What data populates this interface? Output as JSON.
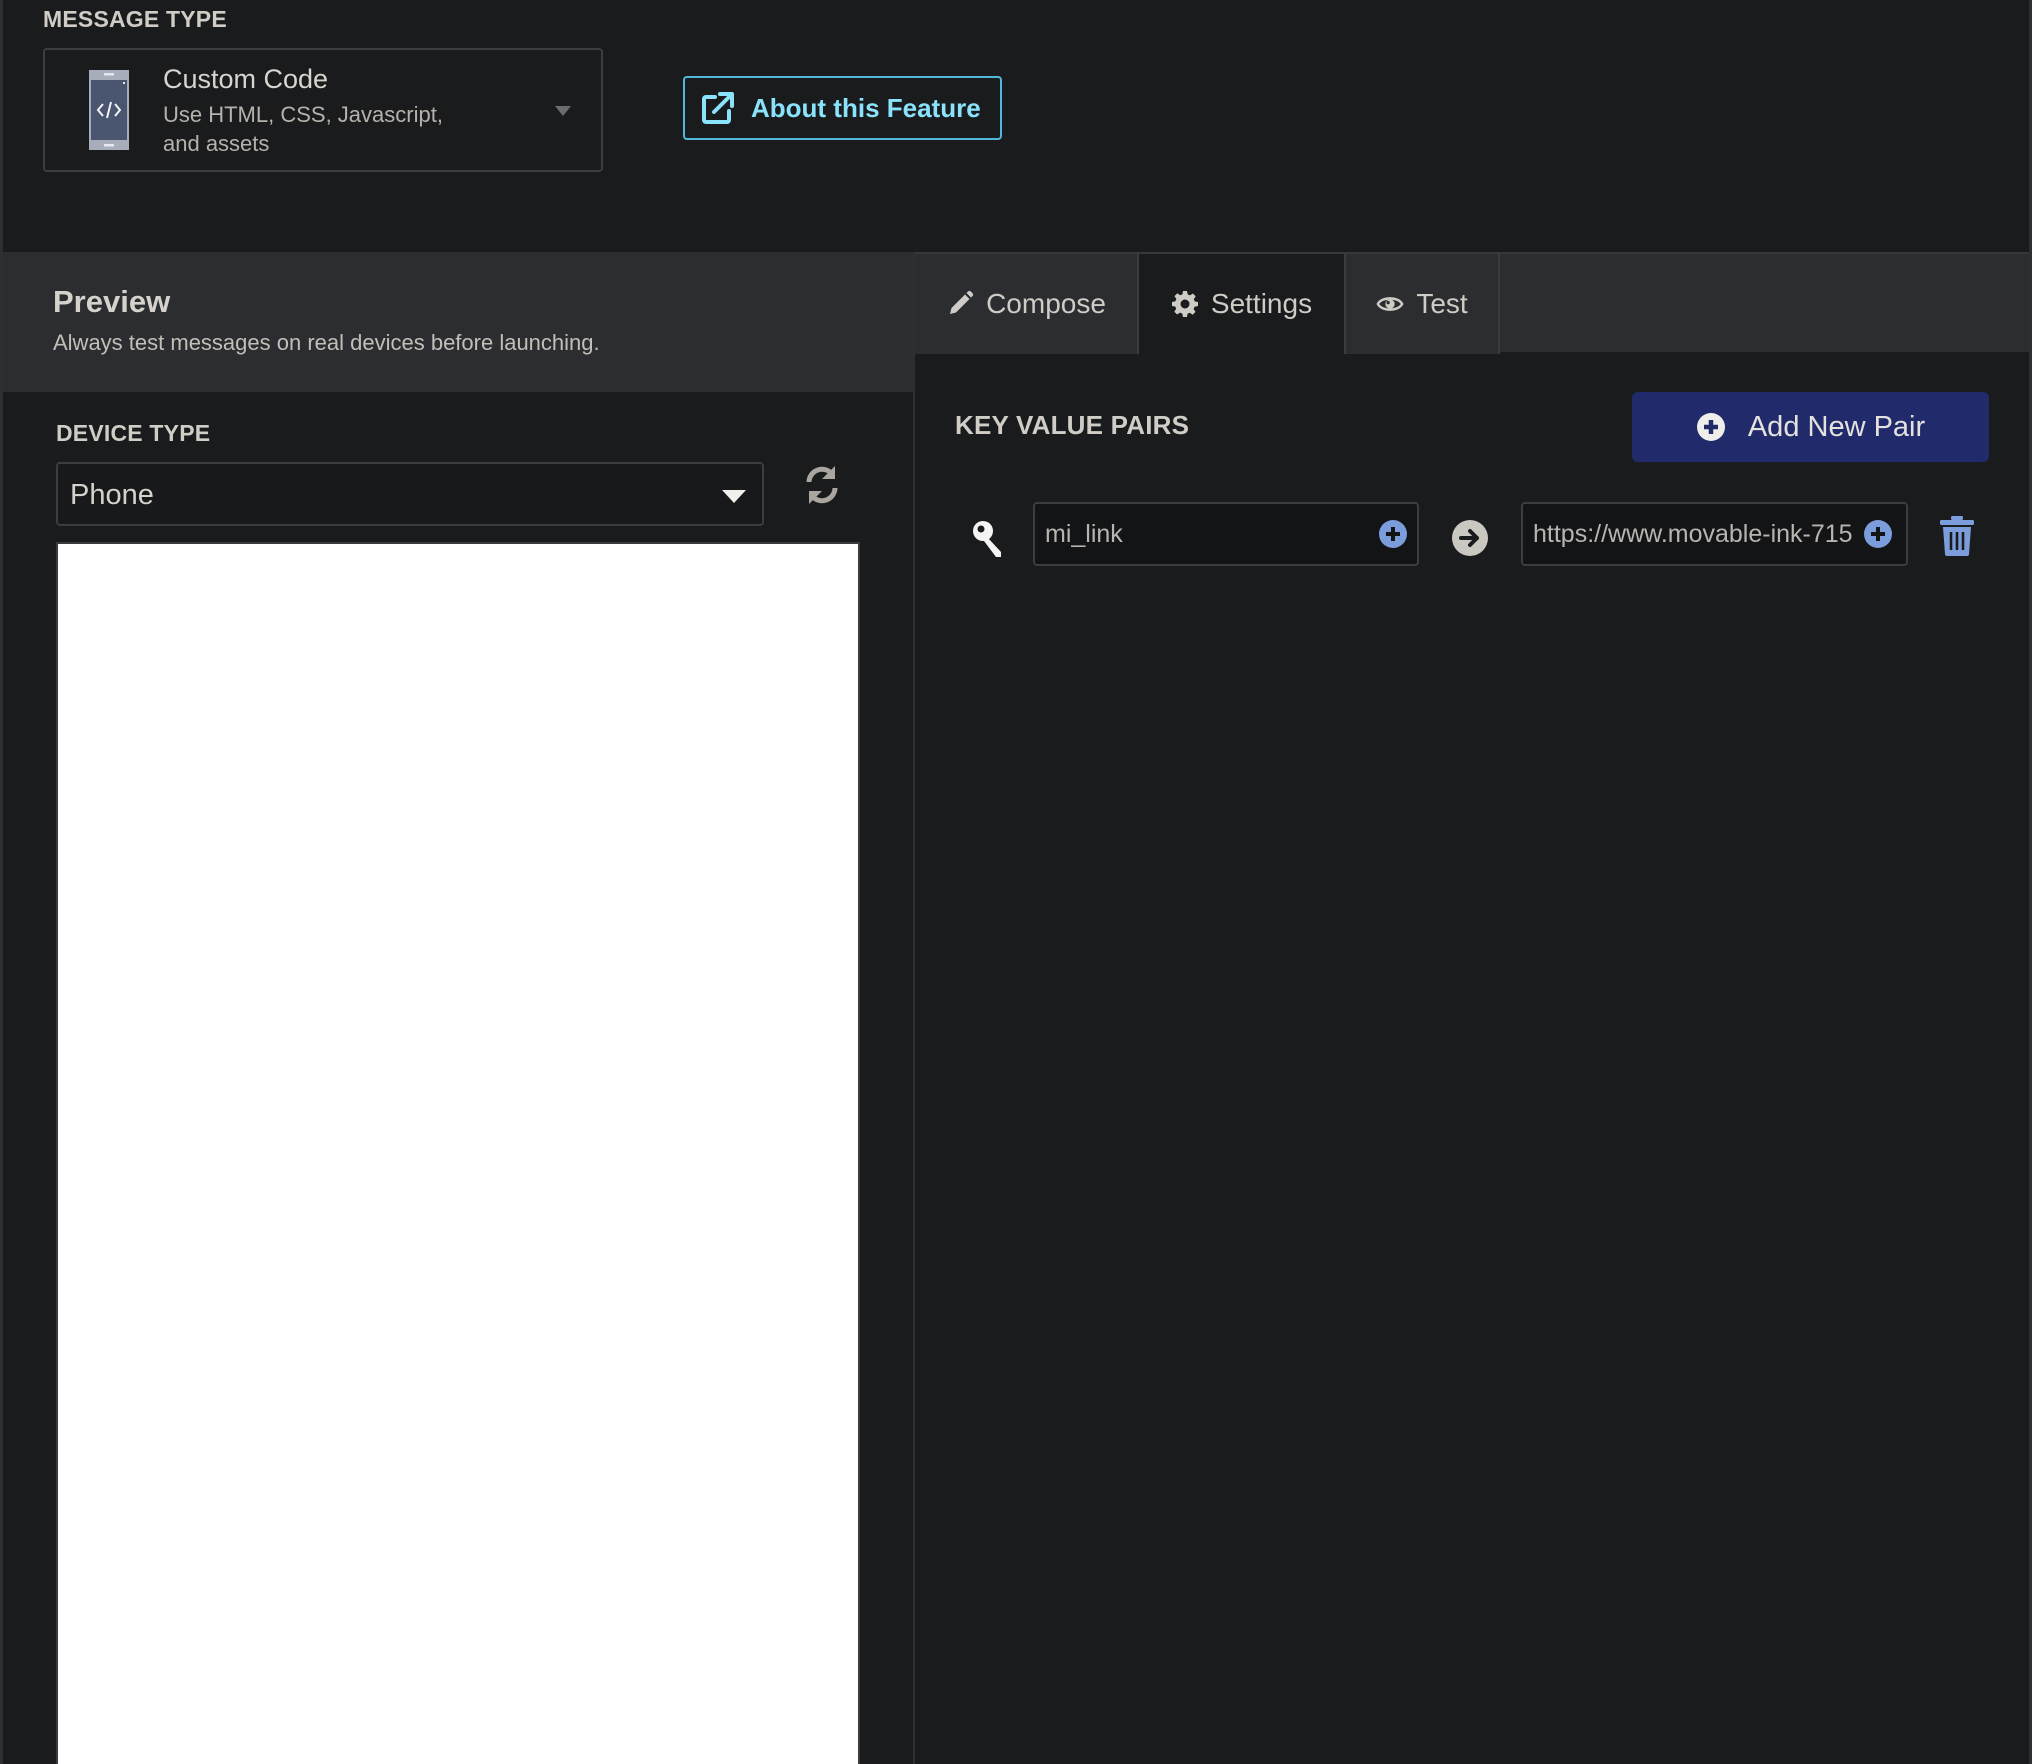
{
  "message_type": {
    "label": "MESSAGE TYPE",
    "selected": {
      "title": "Custom Code",
      "description": "Use HTML, CSS, Javascript, and assets",
      "icon": "phone-code-icon"
    },
    "about_button": "About this Feature"
  },
  "preview": {
    "title": "Preview",
    "subtitle": "Always test messages on real devices before launching.",
    "device_type_label": "DEVICE TYPE",
    "device_type_value": "Phone"
  },
  "tabs": [
    {
      "label": "Compose",
      "icon": "pencil-icon",
      "active": false
    },
    {
      "label": "Settings",
      "icon": "gear-icon",
      "active": true
    },
    {
      "label": "Test",
      "icon": "eye-icon",
      "active": false
    }
  ],
  "settings": {
    "kv_label": "KEY VALUE PAIRS",
    "add_button": "Add New Pair",
    "pairs": [
      {
        "key": "mi_link",
        "value": "https://www.movable-ink-715"
      }
    ]
  },
  "colors": {
    "accent_cyan": "#8be2fb",
    "primary_button": "#212a6b",
    "badge_blue": "#7c9ddc",
    "background": "#1a1b1d",
    "panel": "#2c2d30"
  }
}
